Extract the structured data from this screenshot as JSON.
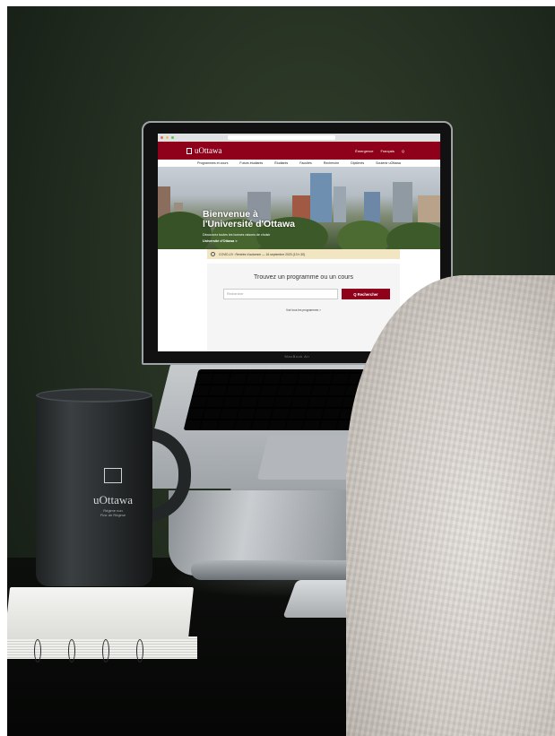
{
  "website": {
    "logo_text": "uOttawa",
    "header_links": [
      "Émergence",
      "Français",
      "Q"
    ],
    "nav_items": [
      "Programmes et cours",
      "Futurs étudiants",
      "Étudiants",
      "Facultés",
      "Recherche",
      "Diplômés",
      "Soutenir uOttawa"
    ],
    "hero_title_line1": "Bienvenue à",
    "hero_title_line2": "l'Université d'Ottawa",
    "hero_subtitle": "Découvrez toutes les bonnes raisons de choisir",
    "hero_link": "Université d'Ottawa >",
    "alert_text": "COVID-19 : Rentrée d'automne — 16 septembre 2020 (13 h 30)",
    "search_title": "Trouvez un programme ou un cours",
    "search_placeholder": "Rechercher",
    "search_button": "Q Rechercher",
    "all_programs_link": "Voir tous les programmes >"
  },
  "laptop_label": "MacBook Air",
  "mug": {
    "brand": "uOttawa",
    "small_text_line1": "Régime non",
    "small_text_line2": "Fine de Régime"
  },
  "colors": {
    "brand_red": "#8f001a",
    "wall_green": "#253022"
  }
}
